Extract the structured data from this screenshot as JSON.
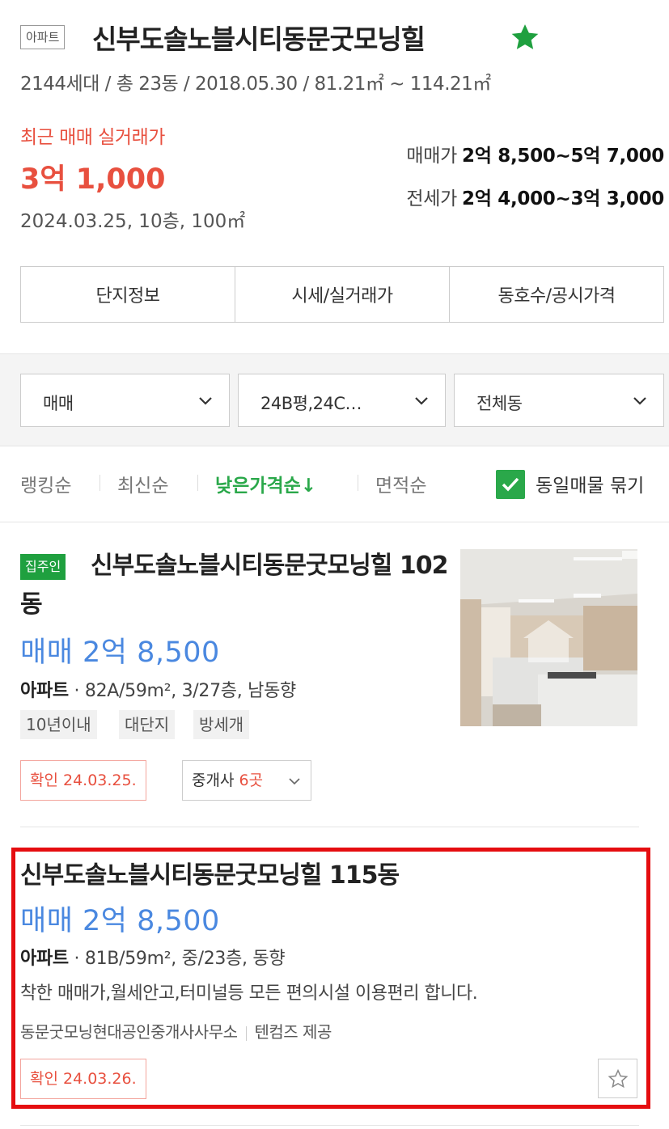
{
  "complex": {
    "type_badge": "아파트",
    "name": "신부도솔노블시티동문굿모닝힐",
    "summary": "2144세대 / 총 23동 / 2018.05.30 / 81.21㎡ ~ 114.21㎡",
    "recent_label": "최근 매매 실거래가",
    "recent_price": "3억 1,000",
    "recent_detail": "2024.03.25, 10층, 100㎡",
    "sale_label": "매매가",
    "sale_range": "2억 8,500~5억 7,000",
    "jeonse_label": "전세가",
    "jeonse_range": "2억 4,000~3억 3,000",
    "star_color": "#1fa03f"
  },
  "tabs": [
    "단지정보",
    "시세/실거래가",
    "동호수/공시가격"
  ],
  "filters": {
    "trade_type": "매매",
    "area": "24B평,24C…",
    "dong": "전체동"
  },
  "sort": {
    "items": [
      "랭킹순",
      "최신순",
      "낮은가격순↓",
      "면적순"
    ],
    "active_index": 2,
    "group_checkbox_label": "동일매물 묶기",
    "group_checked": true
  },
  "listings": [
    {
      "owner_badge": "집주인",
      "title": "신부도솔노블시티동문굿모닝힐 102동",
      "price": "매매 2억 8,500",
      "spec_type": "아파트",
      "spec": " · 82A/59m², 3/27층, 남동향",
      "tags": [
        "10년이내",
        "대단지",
        "방세개"
      ],
      "verified": "확인 24.03.25.",
      "agency_label": "중개사",
      "agency_count": "6곳"
    },
    {
      "title": "신부도솔노블시티동문굿모닝힐 115동",
      "price": "매매 2억 8,500",
      "spec_type": "아파트",
      "spec": " · 81B/59m², 중/23층, 동향",
      "description": "착한 매매가,월세안고,터미널등 모든 편의시설 이용편리 합니다.",
      "agent": "동문굿모닝현대공인중개사사무소",
      "provider": "텐컴즈 제공",
      "verified": "확인 24.03.26."
    }
  ],
  "colors": {
    "accent_green": "#2aa84a",
    "price_blue": "#4a88e0",
    "alert_red": "#e8503f",
    "highlight_red": "#e50d10"
  }
}
